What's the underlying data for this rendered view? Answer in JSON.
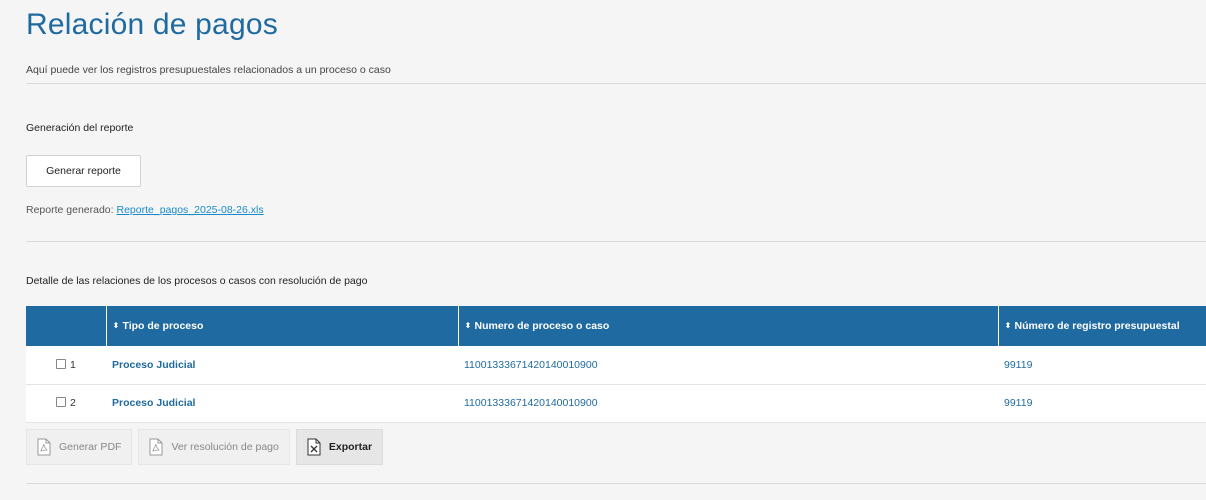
{
  "header": {
    "title": "Relación de pagos",
    "subtitle": "Aquí puede ver los registros presupuestales relacionados a un proceso o caso"
  },
  "report": {
    "section_label": "Generación del reporte",
    "generate_label": "Generar reporte",
    "generated_prefix": "Reporte generado:",
    "generated_file": "Reporte_pagos_2025-08-26.xls"
  },
  "detail": {
    "section_label": "Detalle de las relaciones de los procesos o casos con resolución de pago"
  },
  "table": {
    "columns": [
      "Tipo de proceso",
      "Numero de proceso o caso",
      "Número de registro presupuestal"
    ],
    "rows": [
      {
        "index": "1",
        "tipo": "Proceso Judicial",
        "numero": "11001333671420140010900",
        "registro": "99119"
      },
      {
        "index": "2",
        "tipo": "Proceso Judicial",
        "numero": "11001333671420140010900",
        "registro": "99119"
      }
    ]
  },
  "actions": {
    "pdf_label": "Generar PDF",
    "resolution_label": "Ver resolución de pago",
    "export_label": "Exportar"
  },
  "colors": {
    "primary": "#1f6aa0",
    "link": "#1a8bc8",
    "background": "#f5f5f5"
  },
  "icons": {
    "sort": "sort-icon",
    "pdf": "pdf-document-icon",
    "excel": "excel-document-icon"
  }
}
